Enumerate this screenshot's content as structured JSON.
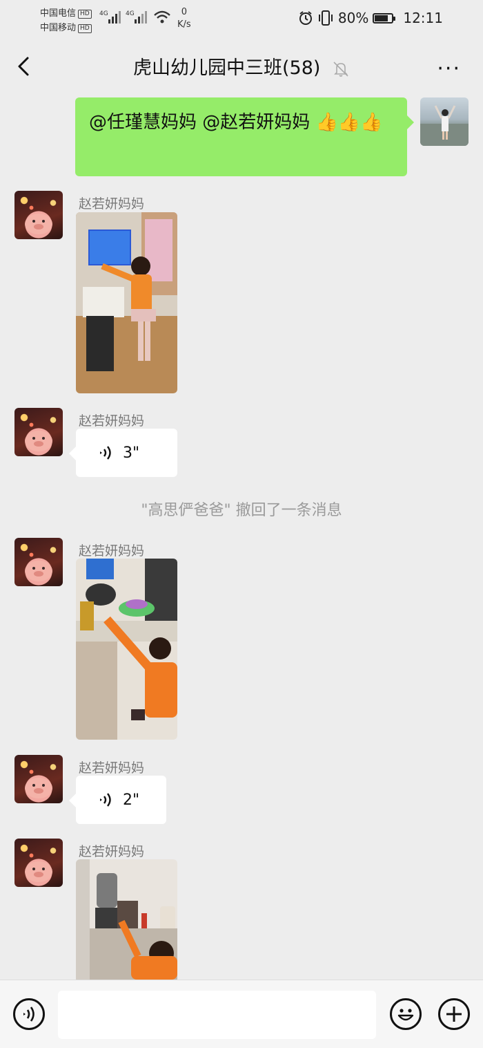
{
  "status_bar": {
    "carrier1": "中国电信",
    "carrier2": "中国移动",
    "hd_badge": "HD",
    "network_type": "4G",
    "net_speed_value": "0",
    "net_speed_unit": "K/s",
    "battery_percent": "80%",
    "battery_level": 0.8,
    "time": "12:11"
  },
  "header": {
    "title": "虎山幼儿园中三班(58)",
    "back_icon": "chevron-left-icon",
    "mute_icon": "bell-off-icon",
    "more_label": "···"
  },
  "messages": [
    {
      "type": "text",
      "from_self": true,
      "text_parts": [
        "@任瑾慧妈妈  @赵若妍妈妈 ",
        "👍👍👍"
      ]
    },
    {
      "type": "image",
      "from_self": false,
      "sender": "赵若妍妈妈"
    },
    {
      "type": "voice",
      "from_self": false,
      "sender": "赵若妍妈妈",
      "duration": "3\""
    },
    {
      "type": "system",
      "text": "\"高思俨爸爸\" 撤回了一条消息"
    },
    {
      "type": "image",
      "from_self": false,
      "sender": "赵若妍妈妈"
    },
    {
      "type": "voice",
      "from_self": false,
      "sender": "赵若妍妈妈",
      "duration": "2\""
    },
    {
      "type": "image",
      "from_self": false,
      "sender": "赵若妍妈妈"
    }
  ],
  "input_bar": {
    "voice_icon": "voice-input-icon",
    "emoji_icon": "emoji-icon",
    "plus_icon": "plus-icon",
    "placeholder": ""
  },
  "colors": {
    "background": "#ededed",
    "self_bubble": "#95ec69",
    "other_bubble": "#ffffff",
    "system_text": "#9a9a9a"
  }
}
